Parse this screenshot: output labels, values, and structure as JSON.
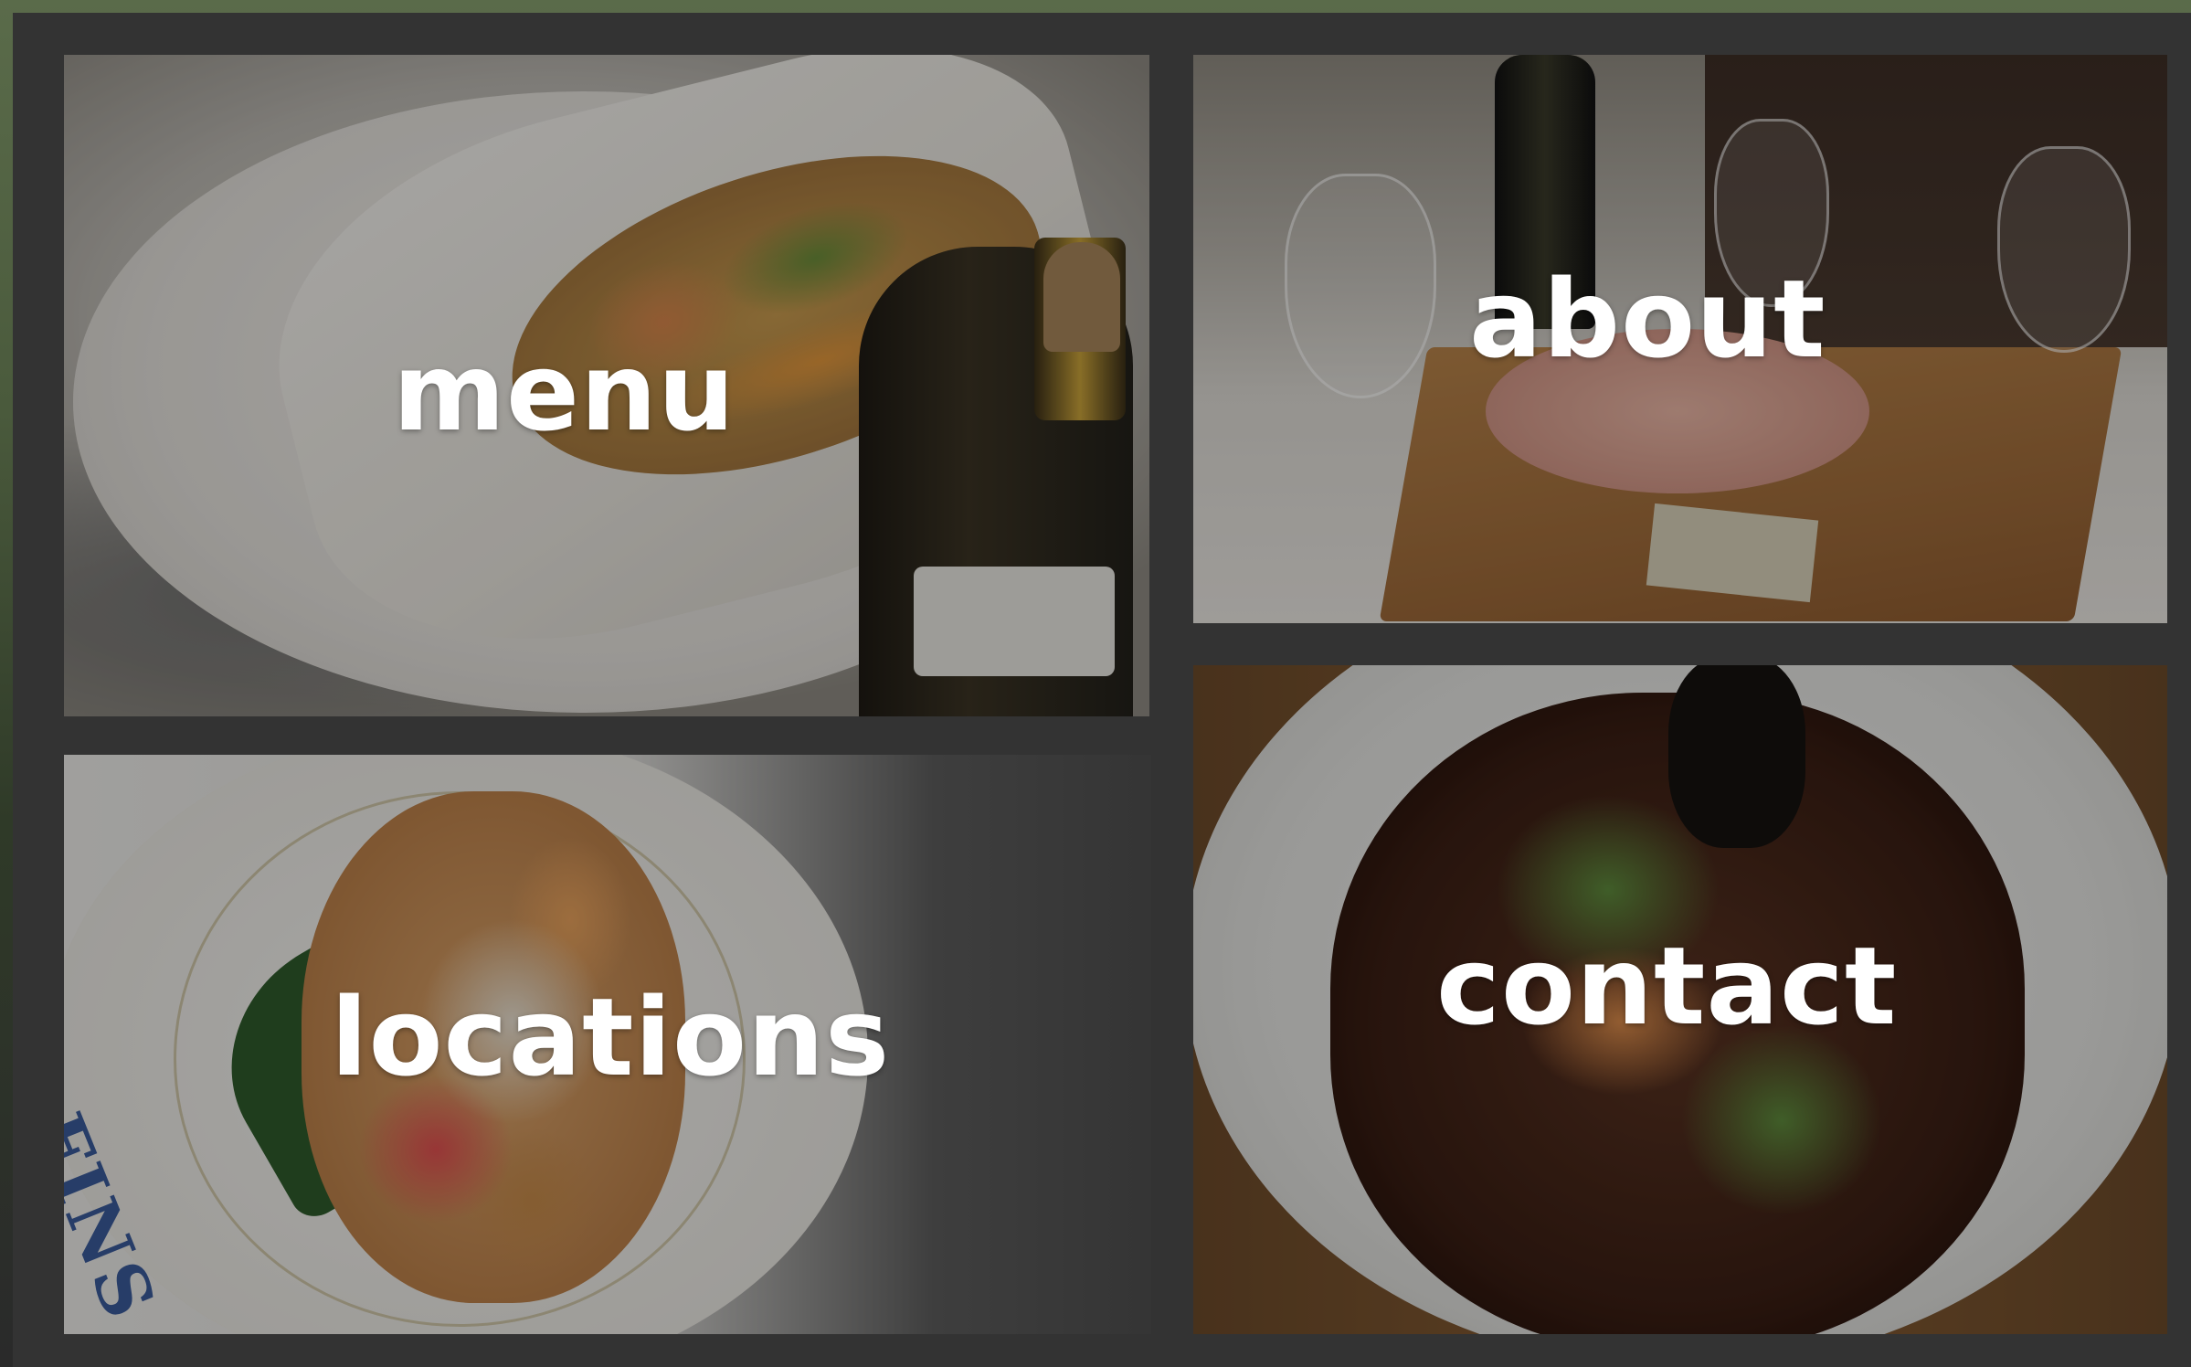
{
  "tiles": [
    {
      "id": "menu",
      "label": "menu"
    },
    {
      "id": "about",
      "label": "about"
    },
    {
      "id": "locations",
      "label": "locations",
      "plate_text": "FINS"
    },
    {
      "id": "contact",
      "label": "contact"
    }
  ],
  "colors": {
    "frame": "#333333",
    "label_text": "#ffffff",
    "plate_text": "#3a5a9a"
  }
}
